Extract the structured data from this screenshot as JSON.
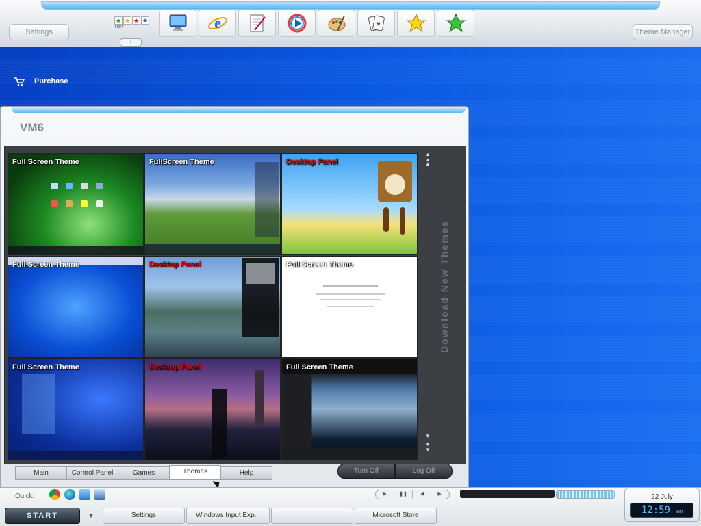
{
  "toolbar": {
    "settings_label": "Settings",
    "theme_manager_label": "Theme Manager",
    "rating_caption": "TOP",
    "mini_tab": "+",
    "apps": [
      {
        "icon": "monitor-icon"
      },
      {
        "icon": "internet-explorer-icon"
      },
      {
        "icon": "notepad-icon"
      },
      {
        "icon": "media-player-icon"
      },
      {
        "icon": "paint-palette-icon"
      },
      {
        "icon": "cards-icon"
      },
      {
        "icon": "yellow-star-icon"
      },
      {
        "icon": "green-star-icon"
      }
    ]
  },
  "purchase": {
    "label": "Purchase",
    "icon": "cart-icon"
  },
  "window": {
    "title": "VM6",
    "side_text": "Download New Themes",
    "themes": [
      {
        "label": "Full Screen Theme",
        "label_color": "white"
      },
      {
        "label": "FullScreen Theme",
        "label_color": "white"
      },
      {
        "label": "Desktop Panel",
        "label_color": "red"
      },
      {
        "label": "Full Screen Theme",
        "label_color": "white"
      },
      {
        "label": "Desktop Panel",
        "label_color": "red"
      },
      {
        "label": "Full Screen Theme",
        "label_color": "white"
      },
      {
        "label": "Full Screen Theme",
        "label_color": "white"
      },
      {
        "label": "Desktop Panel",
        "label_color": "red"
      },
      {
        "label": "Full Screen Theme",
        "label_color": "white"
      }
    ],
    "tabs": [
      {
        "label": "Main"
      },
      {
        "label": "Control Panel"
      },
      {
        "label": "Games"
      },
      {
        "label": "Themes",
        "active": true
      },
      {
        "label": "Help"
      }
    ],
    "turn_off_label": "Turn Off",
    "log_off_label": "Log Off"
  },
  "quickbar": {
    "label": "Quick:",
    "icons": [
      "chrome-icon",
      "edge-icon",
      "computer-icon",
      "network-icon"
    ]
  },
  "clock": {
    "date": "22 July",
    "time": "12:59",
    "ampm": "am"
  },
  "taskbar": {
    "start_label": "START",
    "items": [
      {
        "label": "Settings"
      },
      {
        "label": "Windows Input Exp..."
      },
      {
        "label": ""
      },
      {
        "label": "Microsoft Store"
      }
    ]
  },
  "colors": {
    "desktop": "#0b55d8",
    "accent": "#57b4f2",
    "desktop_panel_label": "#e00000"
  }
}
